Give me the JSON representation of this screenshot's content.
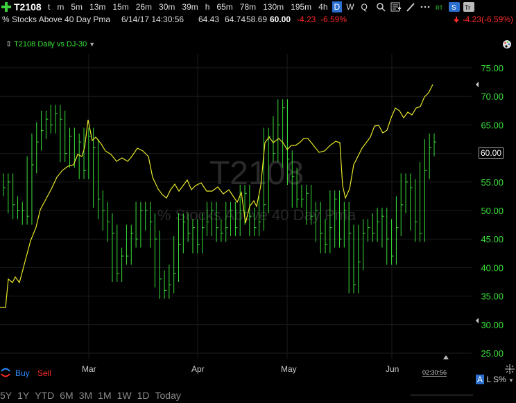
{
  "toolbar": {
    "symbol": "T2108",
    "timeframes": [
      "t",
      "m",
      "5m",
      "13m",
      "15m",
      "26m",
      "30m",
      "39m",
      "h",
      "65m",
      "78m",
      "130m",
      "195m",
      "4h",
      "D",
      "W",
      "Q"
    ],
    "active_timeframe": "D",
    "icons": [
      "search-icon",
      "chart-settings-icon",
      "draw-icon",
      "more-icon",
      "realtime-badge",
      "s-badge",
      "tt-badge"
    ]
  },
  "info": {
    "name": "% Stocks Above 40 Day Pma",
    "datetime": "6/14/17 14:30:56",
    "open": "64.43",
    "high": "64.74",
    "low": "58.69",
    "last": "60.00",
    "change": "-4.23",
    "change_pct": "-6.59%",
    "right_change": "-4.23(-6.59%)"
  },
  "legend": {
    "label": "T2108 Daily vs DJ-30"
  },
  "watermark": {
    "symbol": "T2108",
    "name": "% Stocks Above 40 Day Pma"
  },
  "yaxis": {
    "labels": [
      "75.00",
      "70.00",
      "65.00",
      "60.00",
      "55.00",
      "50.00",
      "45.00",
      "40.00",
      "35.00",
      "30.00",
      "25.00"
    ],
    "price_tag": "60.00"
  },
  "xaxis": {
    "months": [
      "Mar",
      "Apr",
      "May",
      "Jun"
    ]
  },
  "trade": {
    "buy": "Buy",
    "sell": "Sell"
  },
  "clock": "02:30:56",
  "axis_controls": {
    "a": "A",
    "l": "L",
    "s": "S%"
  },
  "ranges": [
    "5Y",
    "1Y",
    "YTD",
    "6M",
    "3M",
    "1M",
    "1W",
    "1D",
    "Today"
  ],
  "colors": {
    "bars": "#39e139",
    "compare_line": "#e8e82a",
    "down": "#ff2a2a",
    "accent": "#2b6fd1"
  },
  "chart_data": {
    "type": "line",
    "y_range": [
      25,
      75
    ],
    "series": [
      {
        "name": "T2108",
        "kind": "hlc-bars",
        "values": [
          54,
          55,
          51,
          50,
          50,
          49,
          58,
          62,
          64,
          66,
          65,
          67,
          66,
          60,
          63,
          59,
          62,
          57,
          63,
          61,
          52,
          50,
          48,
          46,
          39,
          42,
          42,
          46,
          45,
          50,
          50,
          48,
          45,
          38,
          36,
          37,
          39,
          44,
          48,
          46,
          47,
          44,
          47,
          48,
          50,
          47,
          46,
          47,
          50,
          47,
          50,
          53,
          49,
          47,
          48,
          51,
          63,
          60,
          65,
          68,
          59,
          56,
          52,
          52,
          53,
          49,
          50,
          46,
          44,
          47,
          52,
          45,
          50,
          46,
          37,
          41,
          46,
          47,
          46,
          48,
          49,
          45,
          42,
          47,
          51,
          55,
          54,
          48,
          46,
          57,
          61,
          62
        ]
      },
      {
        "name": "DJ-30",
        "kind": "line"
      }
    ]
  }
}
